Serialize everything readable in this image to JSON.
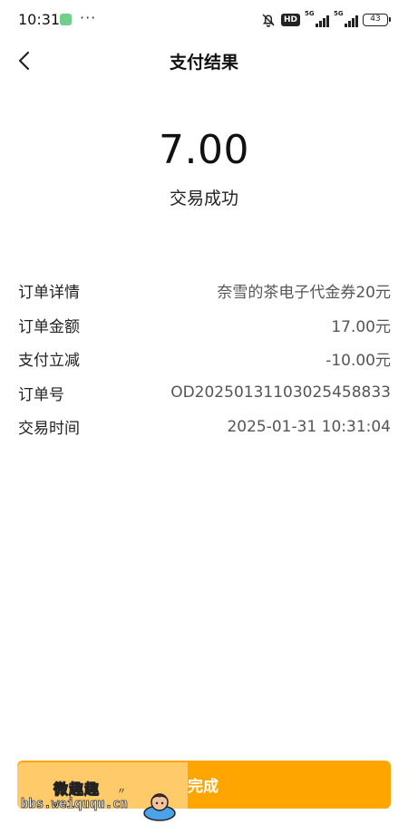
{
  "status_bar": {
    "time": "10:31",
    "more": "···",
    "hd": "HD",
    "net1": "5G",
    "net2": "5G",
    "battery": "43"
  },
  "nav": {
    "title": "支付结果",
    "back_icon": "chevron-left-icon"
  },
  "payment": {
    "amount": "7.00",
    "result": "交易成功"
  },
  "details": [
    {
      "label": "订单详情",
      "value": "奈雪的茶电子代金券20元"
    },
    {
      "label": "订单金额",
      "value": "17.00元"
    },
    {
      "label": "支付立减",
      "value": "-10.00元"
    },
    {
      "label": "订单号",
      "value": "OD20250131103025458833"
    },
    {
      "label": "交易时间",
      "value": "2025-01-31 10:31:04"
    }
  ],
  "footer": {
    "done_label": "完成"
  },
  "watermark": {
    "title": "微趣趣",
    "url": "bbs.weiququ.cn"
  },
  "colors": {
    "accent": "#ffa500",
    "text": "#222222",
    "value_text": "#555555"
  }
}
